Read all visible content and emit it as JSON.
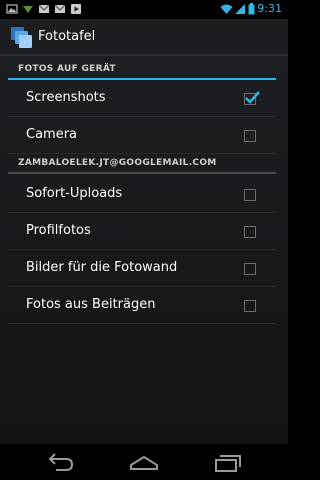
{
  "status_bar": {
    "time": "9:31",
    "notification_icons": [
      "image-icon",
      "download-icon",
      "gmail-icon",
      "gmail-icon",
      "play-icon"
    ],
    "system_icons": [
      "wifi-icon",
      "signal-icon",
      "battery-icon"
    ],
    "accent_color": "#33b5e5"
  },
  "action_bar": {
    "title": "Fototafel",
    "icon": "photo-stack-icon"
  },
  "sections": {
    "device": {
      "title": "FOTOS AUF GERÄT",
      "items": [
        {
          "label": "Screenshots",
          "checked": true
        },
        {
          "label": "Camera",
          "checked": false
        }
      ]
    },
    "account": {
      "title": "ZAMBALOELEK.JT@GOOGLEMAIL.COM",
      "items": [
        {
          "label": "Sofort-Uploads",
          "checked": false
        },
        {
          "label": "Profilfotos",
          "checked": false
        },
        {
          "label": "Bilder für die Fotowand",
          "checked": false
        },
        {
          "label": "Fotos aus Beiträgen",
          "checked": false
        }
      ]
    }
  },
  "nav_bar": {
    "buttons": [
      "back-icon",
      "home-icon",
      "recent-apps-icon"
    ]
  }
}
